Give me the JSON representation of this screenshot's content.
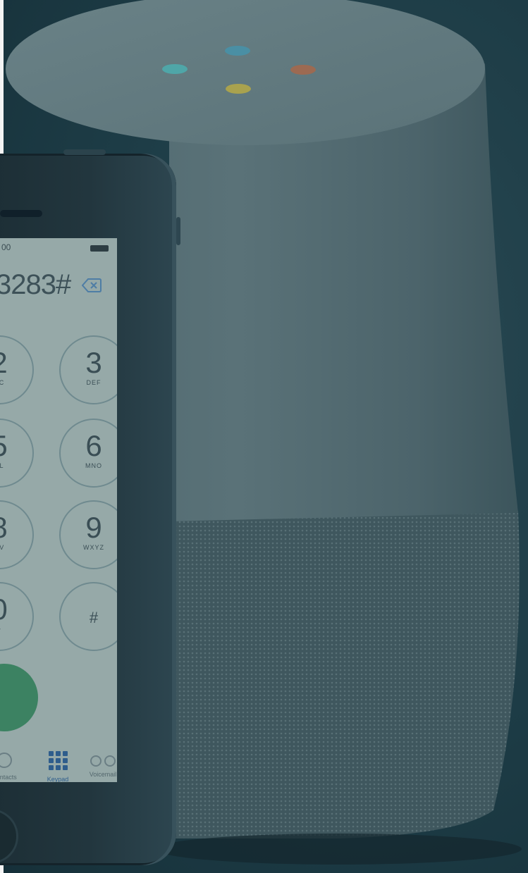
{
  "dialer": {
    "status_time": "00",
    "number": "3283#",
    "keys": [
      {
        "digit": "2",
        "letters": "BC",
        "kind": "partial"
      },
      {
        "digit": "3",
        "letters": "DEF",
        "kind": "full"
      },
      {
        "digit": "5",
        "letters": "KL",
        "kind": "partial"
      },
      {
        "digit": "6",
        "letters": "MNO",
        "kind": "full"
      },
      {
        "digit": "8",
        "letters": "UV",
        "kind": "partial"
      },
      {
        "digit": "9",
        "letters": "WXYZ",
        "kind": "full"
      },
      {
        "digit": "0",
        "letters": "+",
        "kind": "partial"
      },
      {
        "digit": "#",
        "letters": "",
        "kind": "full"
      }
    ],
    "tabs": {
      "contacts": "Contacts",
      "keypad": "Keypad",
      "voicemail": "Voicemail"
    }
  },
  "colors": {
    "background": "#1c3a44",
    "speaker_led_1": "#4fa6a8",
    "speaker_led_2": "#4a8fa4",
    "speaker_led_3": "#a9a24e",
    "speaker_led_4": "#9c6a52",
    "call_button": "#3c8262",
    "keypad_active": "#2e5d8c"
  }
}
